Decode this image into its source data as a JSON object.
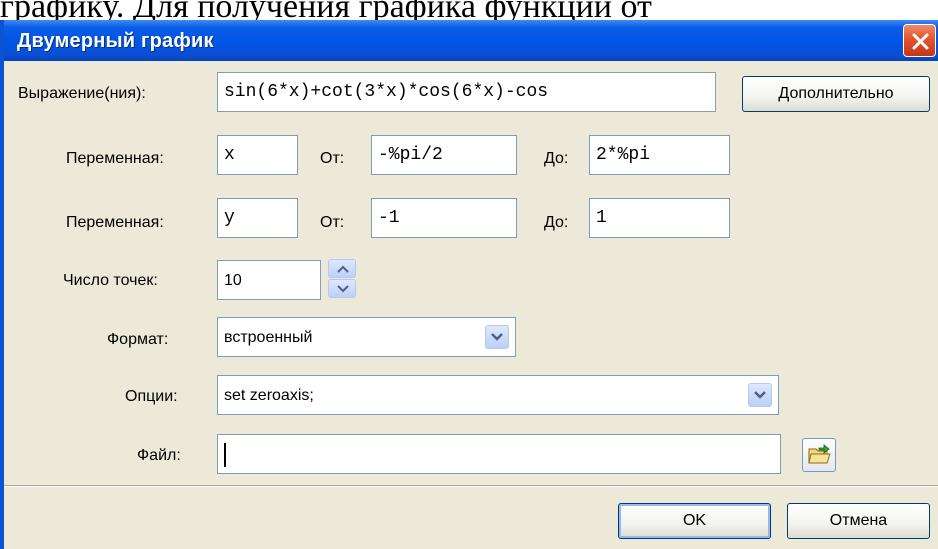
{
  "background_text": "графику. Для получения графика функции от",
  "dialog": {
    "title": "Двумерный график",
    "close_icon": "close-icon"
  },
  "expression": {
    "label": "Выражение(ния):",
    "value": "sin(6*x)+cot(3*x)*cos(6*x)-cos",
    "more_button": "Дополнительно"
  },
  "var1": {
    "label": "Переменная:",
    "name": "x",
    "from_label": "От:",
    "from": "-%pi/2",
    "to_label": "До:",
    "to": "2*%pi"
  },
  "var2": {
    "label": "Переменная:",
    "name": "y",
    "from_label": "От:",
    "from": "-1",
    "to_label": "До:",
    "to": "1"
  },
  "points": {
    "label": "Число точек:",
    "value": "10"
  },
  "format": {
    "label": "Формат:",
    "value": "встроенный"
  },
  "options": {
    "label": "Опции:",
    "value": "set zeroaxis;"
  },
  "file": {
    "label": "Файл:",
    "value": ""
  },
  "buttons": {
    "ok": "OK",
    "cancel": "Отмена"
  },
  "colors": {
    "titlebar": "#0055e5",
    "dialog_bg": "#ece9d8",
    "close": "#e2552c",
    "field_border": "#7f9db9"
  }
}
